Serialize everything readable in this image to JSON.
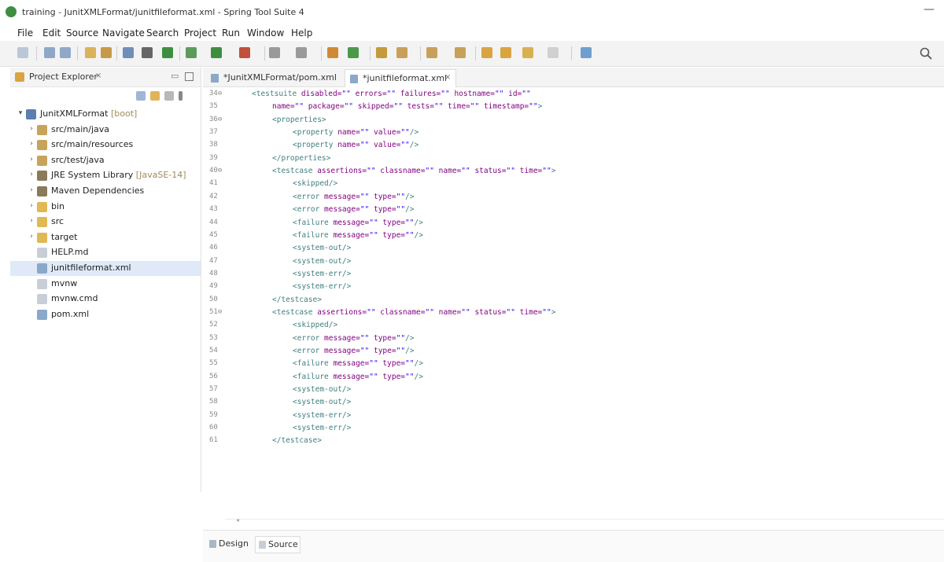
{
  "window": {
    "title": "training - JunitXMLFormat/junitfileformat.xml - Spring Tool Suite 4",
    "minimize_glyph": "—"
  },
  "menubar": [
    "File",
    "Edit",
    "Source",
    "Navigate",
    "Search",
    "Project",
    "Run",
    "Window",
    "Help"
  ],
  "explorer": {
    "tab_label": "Project Explorer",
    "close_glyph": "⨯",
    "minimize_glyph": "▭",
    "tree": [
      {
        "label": "JunitXMLFormat",
        "decoration": "[boot]",
        "level": 0,
        "expanded": true,
        "icon": "project-icon"
      },
      {
        "label": "src/main/java",
        "level": 1,
        "icon": "source-folder-icon"
      },
      {
        "label": "src/main/resources",
        "level": 1,
        "icon": "source-folder-icon"
      },
      {
        "label": "src/test/java",
        "level": 1,
        "icon": "source-folder-icon"
      },
      {
        "label": "JRE System Library",
        "decoration": "[JavaSE-14]",
        "level": 1,
        "icon": "library-icon"
      },
      {
        "label": "Maven Dependencies",
        "level": 1,
        "icon": "library-icon"
      },
      {
        "label": "bin",
        "level": 1,
        "icon": "folder-icon"
      },
      {
        "label": "src",
        "level": 1,
        "icon": "folder-icon"
      },
      {
        "label": "target",
        "level": 1,
        "icon": "folder-icon"
      },
      {
        "label": "HELP.md",
        "level": 1,
        "icon": "file-icon",
        "leaf": true
      },
      {
        "label": "junitfileformat.xml",
        "level": 1,
        "icon": "xml-file-icon",
        "leaf": true,
        "selected": true
      },
      {
        "label": "mvnw",
        "level": 1,
        "icon": "file-icon",
        "leaf": true
      },
      {
        "label": "mvnw.cmd",
        "level": 1,
        "icon": "file-icon",
        "leaf": true
      },
      {
        "label": "pom.xml",
        "level": 1,
        "icon": "xml-file-icon",
        "leaf": true
      }
    ]
  },
  "editor": {
    "tabs": [
      {
        "label": "*JunitXMLFormat/pom.xml",
        "active": false
      },
      {
        "label": "*junitfileformat.xml",
        "active": true
      }
    ],
    "lines": [
      {
        "n": "34⊖",
        "indent": 0,
        "segs": [
          [
            "t",
            "<testsuite "
          ],
          [
            "a",
            "disabled="
          ],
          [
            "v",
            "\"\" "
          ],
          [
            "a",
            "errors="
          ],
          [
            "v",
            "\"\" "
          ],
          [
            "a",
            "failures="
          ],
          [
            "v",
            "\"\" "
          ],
          [
            "a",
            "hostname="
          ],
          [
            "v",
            "\"\" "
          ],
          [
            "a",
            "id="
          ],
          [
            "v",
            "\"\""
          ]
        ]
      },
      {
        "n": "35",
        "indent": 1,
        "segs": [
          [
            "a",
            "name="
          ],
          [
            "v",
            "\"\" "
          ],
          [
            "a",
            "package="
          ],
          [
            "v",
            "\"\" "
          ],
          [
            "a",
            "skipped="
          ],
          [
            "v",
            "\"\" "
          ],
          [
            "a",
            "tests="
          ],
          [
            "v",
            "\"\" "
          ],
          [
            "a",
            "time="
          ],
          [
            "v",
            "\"\" "
          ],
          [
            "a",
            "timestamp="
          ],
          [
            "v",
            "\"\""
          ],
          [
            "t",
            ">"
          ]
        ]
      },
      {
        "n": "36⊖",
        "indent": 1,
        "segs": [
          [
            "t",
            "<properties>"
          ]
        ]
      },
      {
        "n": "37",
        "indent": 2,
        "segs": [
          [
            "t",
            "<property "
          ],
          [
            "a",
            "name="
          ],
          [
            "v",
            "\"\" "
          ],
          [
            "a",
            "value="
          ],
          [
            "v",
            "\"\""
          ],
          [
            "t",
            "/>"
          ]
        ]
      },
      {
        "n": "38",
        "indent": 2,
        "segs": [
          [
            "t",
            "<property "
          ],
          [
            "a",
            "name="
          ],
          [
            "v",
            "\"\" "
          ],
          [
            "a",
            "value="
          ],
          [
            "v",
            "\"\""
          ],
          [
            "t",
            "/>"
          ]
        ]
      },
      {
        "n": "39",
        "indent": 1,
        "segs": [
          [
            "t",
            "</properties>"
          ]
        ]
      },
      {
        "n": "40⊖",
        "indent": 1,
        "segs": [
          [
            "t",
            "<testcase "
          ],
          [
            "a",
            "assertions="
          ],
          [
            "v",
            "\"\" "
          ],
          [
            "a",
            "classname="
          ],
          [
            "v",
            "\"\" "
          ],
          [
            "a",
            "name="
          ],
          [
            "v",
            "\"\" "
          ],
          [
            "a",
            "status="
          ],
          [
            "v",
            "\"\" "
          ],
          [
            "a",
            "time="
          ],
          [
            "v",
            "\"\""
          ],
          [
            "t",
            ">"
          ]
        ]
      },
      {
        "n": "41",
        "indent": 2,
        "segs": [
          [
            "t",
            "<skipped/>"
          ]
        ]
      },
      {
        "n": "42",
        "indent": 2,
        "segs": [
          [
            "t",
            "<error "
          ],
          [
            "a",
            "message="
          ],
          [
            "v",
            "\"\" "
          ],
          [
            "a",
            "type="
          ],
          [
            "v",
            "\"\""
          ],
          [
            "t",
            "/>"
          ]
        ]
      },
      {
        "n": "43",
        "indent": 2,
        "segs": [
          [
            "t",
            "<error "
          ],
          [
            "a",
            "message="
          ],
          [
            "v",
            "\"\" "
          ],
          [
            "a",
            "type="
          ],
          [
            "v",
            "\"\""
          ],
          [
            "t",
            "/>"
          ]
        ]
      },
      {
        "n": "44",
        "indent": 2,
        "segs": [
          [
            "t",
            "<failure "
          ],
          [
            "a",
            "message="
          ],
          [
            "v",
            "\"\" "
          ],
          [
            "a",
            "type="
          ],
          [
            "v",
            "\"\""
          ],
          [
            "t",
            "/>"
          ]
        ]
      },
      {
        "n": "45",
        "indent": 2,
        "segs": [
          [
            "t",
            "<failure "
          ],
          [
            "a",
            "message="
          ],
          [
            "v",
            "\"\" "
          ],
          [
            "a",
            "type="
          ],
          [
            "v",
            "\"\""
          ],
          [
            "t",
            "/>"
          ]
        ]
      },
      {
        "n": "46",
        "indent": 2,
        "segs": [
          [
            "t",
            "<system-out/>"
          ]
        ]
      },
      {
        "n": "47",
        "indent": 2,
        "segs": [
          [
            "t",
            "<system-out/>"
          ]
        ]
      },
      {
        "n": "48",
        "indent": 2,
        "segs": [
          [
            "t",
            "<system-err/>"
          ]
        ]
      },
      {
        "n": "49",
        "indent": 2,
        "segs": [
          [
            "t",
            "<system-err/>"
          ]
        ]
      },
      {
        "n": "50",
        "indent": 1,
        "segs": [
          [
            "t",
            "</testcase>"
          ]
        ]
      },
      {
        "n": "51⊖",
        "indent": 1,
        "segs": [
          [
            "t",
            "<testcase "
          ],
          [
            "a",
            "assertions="
          ],
          [
            "v",
            "\"\" "
          ],
          [
            "a",
            "classname="
          ],
          [
            "v",
            "\"\" "
          ],
          [
            "a",
            "name="
          ],
          [
            "v",
            "\"\" "
          ],
          [
            "a",
            "status="
          ],
          [
            "v",
            "\"\" "
          ],
          [
            "a",
            "time="
          ],
          [
            "v",
            "\"\""
          ],
          [
            "t",
            ">"
          ]
        ]
      },
      {
        "n": "52",
        "indent": 2,
        "segs": [
          [
            "t",
            "<skipped/>"
          ]
        ]
      },
      {
        "n": "53",
        "indent": 2,
        "segs": [
          [
            "t",
            "<error "
          ],
          [
            "a",
            "message="
          ],
          [
            "v",
            "\"\" "
          ],
          [
            "a",
            "type="
          ],
          [
            "v",
            "\"\""
          ],
          [
            "t",
            "/>"
          ]
        ]
      },
      {
        "n": "54",
        "indent": 2,
        "segs": [
          [
            "t",
            "<error "
          ],
          [
            "a",
            "message="
          ],
          [
            "v",
            "\"\" "
          ],
          [
            "a",
            "type="
          ],
          [
            "v",
            "\"\""
          ],
          [
            "t",
            "/>"
          ]
        ]
      },
      {
        "n": "55",
        "indent": 2,
        "segs": [
          [
            "t",
            "<failure "
          ],
          [
            "a",
            "message="
          ],
          [
            "v",
            "\"\" "
          ],
          [
            "a",
            "type="
          ],
          [
            "v",
            "\"\""
          ],
          [
            "t",
            "/>"
          ]
        ]
      },
      {
        "n": "56",
        "indent": 2,
        "segs": [
          [
            "t",
            "<failure "
          ],
          [
            "a",
            "message="
          ],
          [
            "v",
            "\"\" "
          ],
          [
            "a",
            "type="
          ],
          [
            "v",
            "\"\""
          ],
          [
            "t",
            "/>"
          ]
        ]
      },
      {
        "n": "57",
        "indent": 2,
        "segs": [
          [
            "t",
            "<system-out/>"
          ]
        ]
      },
      {
        "n": "58",
        "indent": 2,
        "segs": [
          [
            "t",
            "<system-out/>"
          ]
        ]
      },
      {
        "n": "59",
        "indent": 2,
        "segs": [
          [
            "t",
            "<system-err/>"
          ]
        ]
      },
      {
        "n": "60",
        "indent": 2,
        "segs": [
          [
            "t",
            "<system-err/>"
          ]
        ]
      },
      {
        "n": "61",
        "indent": 1,
        "segs": [
          [
            "t",
            "</testcase>"
          ]
        ]
      }
    ],
    "bottom_tabs": [
      {
        "label": "Design",
        "active": false
      },
      {
        "label": "Source",
        "active": true
      }
    ]
  },
  "colors": {
    "tag": "#3f7f7f",
    "attribute": "#7f007f",
    "value": "#2a00ff",
    "line_number": "#8a8a8a",
    "selection": "#dfe9f7"
  }
}
